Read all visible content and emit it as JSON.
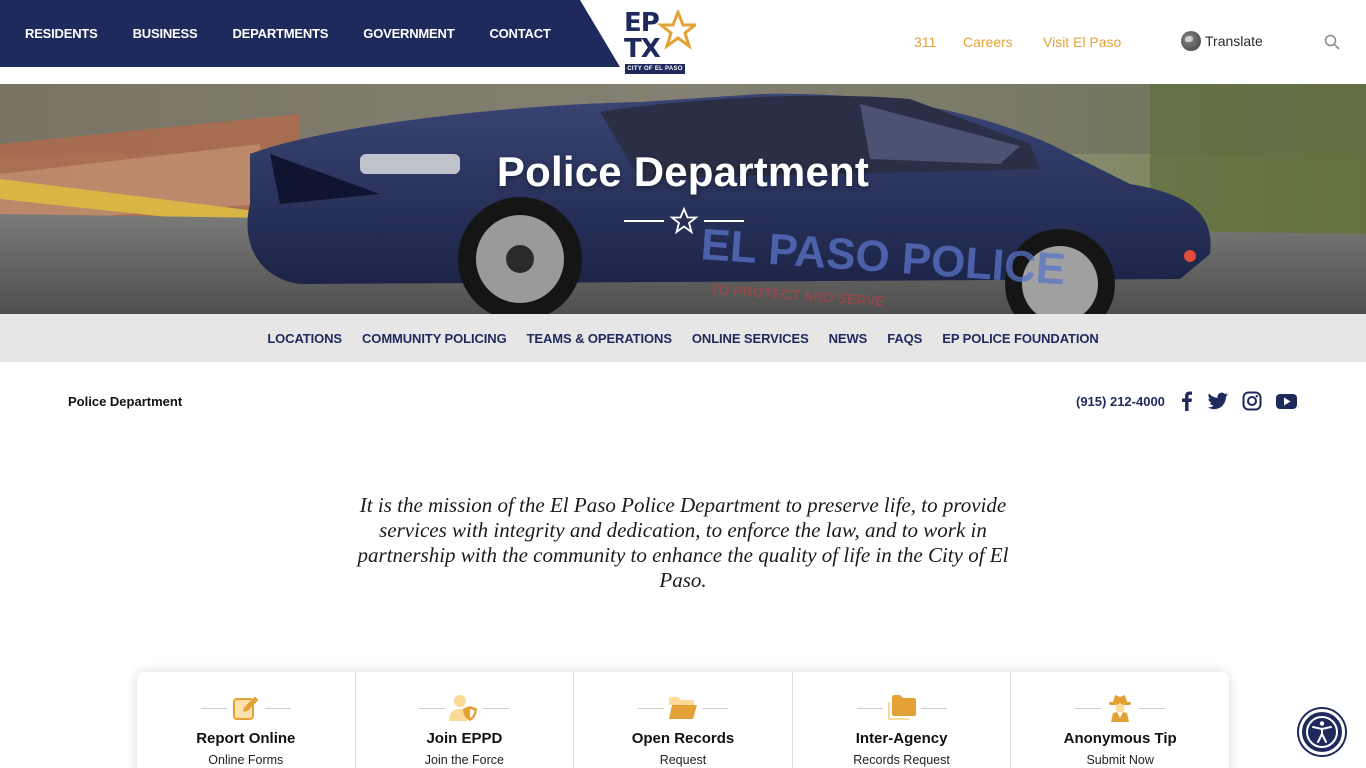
{
  "nav": {
    "items": [
      "RESIDENTS",
      "BUSINESS",
      "DEPARTMENTS",
      "GOVERNMENT",
      "CONTACT"
    ]
  },
  "logo": {
    "line1": "EP",
    "line2": "TX",
    "city": "CITY OF EL PASO"
  },
  "utility": {
    "link_311": "311",
    "careers": "Careers",
    "visit": "Visit El Paso",
    "translate": "Translate"
  },
  "hero": {
    "title": "Police Department",
    "car_text": "EL PASO POLICE",
    "car_motto": "TO PROTECT AND SERVE"
  },
  "subnav": {
    "items": [
      "LOCATIONS",
      "COMMUNITY POLICING",
      "TEAMS & OPERATIONS",
      "ONLINE SERVICES",
      "NEWS",
      "FAQS",
      "EP POLICE FOUNDATION"
    ]
  },
  "breadcrumb": "Police Department",
  "contact": {
    "phone": "(915) 212-4000"
  },
  "social": [
    "facebook",
    "twitter",
    "instagram",
    "youtube"
  ],
  "mission": "It is the mission of the El Paso Police Department to preserve life, to provide services with integrity and dedication, to enforce the law, and to work in partnership with the community to enhance the quality of life in the City of El Paso.",
  "cards": [
    {
      "title": "Report Online",
      "sub": "Online Forms",
      "icon": "edit-icon"
    },
    {
      "title": "Join EPPD",
      "sub": "Join the Force",
      "icon": "user-shield-icon"
    },
    {
      "title": "Open Records",
      "sub": "Request",
      "icon": "folder-open-icon"
    },
    {
      "title": "Inter-Agency",
      "sub": "Records Request",
      "icon": "folders-icon"
    },
    {
      "title": "Anonymous Tip",
      "sub": "Submit Now",
      "icon": "detective-icon"
    }
  ],
  "colors": {
    "navy": "#1f2a5c",
    "gold": "#e4a236",
    "subnav_bg": "#e6e6e6"
  }
}
